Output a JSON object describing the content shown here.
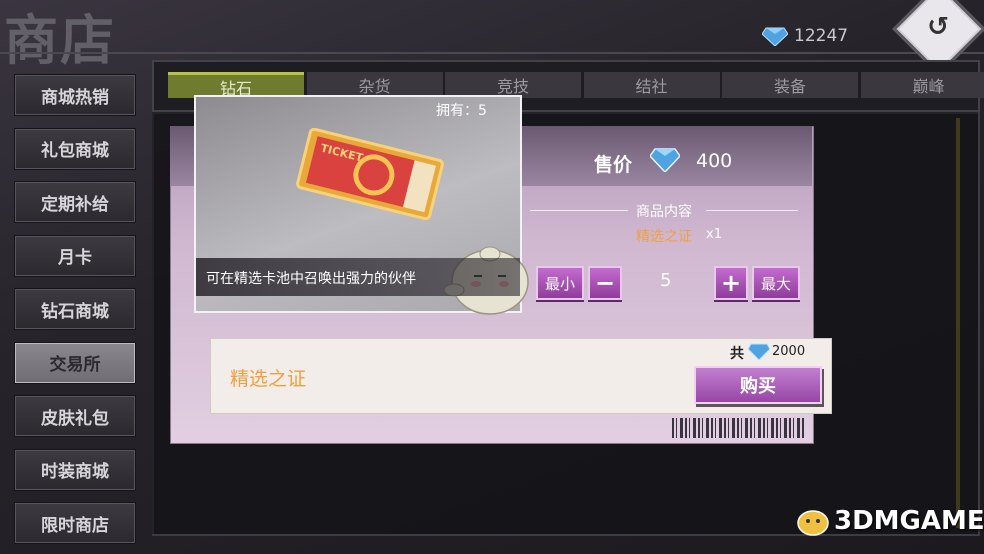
{
  "header": {
    "title": "商店",
    "diamond_count": "12247"
  },
  "sidebar": {
    "items": [
      {
        "label": "商城热销"
      },
      {
        "label": "礼包商城"
      },
      {
        "label": "定期补给"
      },
      {
        "label": "月卡"
      },
      {
        "label": "钻石商城"
      },
      {
        "label": "交易所"
      },
      {
        "label": "皮肤礼包"
      },
      {
        "label": "时装商城"
      },
      {
        "label": "限时商店"
      }
    ],
    "active_index": 5
  },
  "tabs": [
    {
      "label": "钻石"
    },
    {
      "label": "杂货"
    },
    {
      "label": "竞技"
    },
    {
      "label": "结社"
    },
    {
      "label": "装备"
    },
    {
      "label": "巅峰"
    }
  ],
  "active_tab": 0,
  "dialog": {
    "owned_label": "拥有：5",
    "item_description": "可在精选卡池中召唤出强力的伙伴",
    "ticket_text": "TICKET",
    "price_label": "售价",
    "price_value": "400",
    "contents_header": "商品内容",
    "contents_item": "精选之证",
    "contents_qty": "x1",
    "min_label": "最小",
    "minus_label": "−",
    "quantity": "5",
    "plus_label": "+",
    "max_label": "最大",
    "item_name": "精选之证",
    "total_label": "共",
    "total_value": "2000",
    "buy_label": "购买"
  },
  "watermark": "3DMGAME",
  "colors": {
    "accent_purple": "#a24fb0",
    "orange_text": "#f0a040",
    "active_tab": "#6f7c2f"
  }
}
